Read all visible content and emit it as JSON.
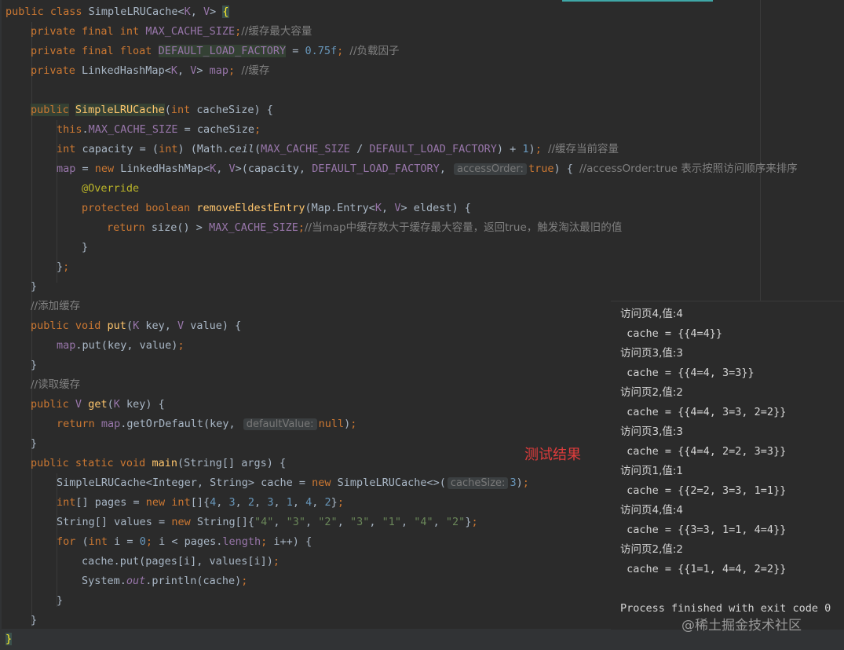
{
  "code": {
    "l1": {
      "kw": "public class ",
      "cls": "SimpleLRUCache",
      "lt": "<",
      "tp1": "K",
      "comma": ", ",
      "tp2": "V",
      "gt": "> ",
      "brace": "{"
    },
    "l2": {
      "kw": "private final int ",
      "fld": "MAX_CACHE_SIZE",
      "semi": ";",
      "cmt": "//缓存最大容量"
    },
    "l3": {
      "kw": "private final float ",
      "fld": "DEFAULT_LOAD_FACTORY",
      "eq": " = ",
      "num": "0.75f",
      "semi": "; ",
      "cmt": "//负载因子"
    },
    "l4": {
      "kw": "private ",
      "type": "LinkedHashMap",
      "lt": "<",
      "tp1": "K",
      "comma": ", ",
      "tp2": "V",
      "gt": "> ",
      "fld": "map",
      "semi": "; ",
      "cmt": "//缓存"
    },
    "l6": {
      "kw": "public",
      "sp": " ",
      "mth": "SimpleLRUCache",
      "lp": "(",
      "kw2": "int",
      "param": " cacheSize) {"
    },
    "l7": {
      "kw": "this",
      "dot": ".",
      "fld": "MAX_CACHE_SIZE",
      "rest": " = cacheSize",
      "semi": ";"
    },
    "l8": {
      "kw": "int",
      "a": " capacity = (",
      "kw2": "int",
      "b": ") (Math.",
      "st": "ceil",
      "c": "(",
      "fld": "MAX_CACHE_SIZE",
      "d": " / ",
      "fld2": "DEFAULT_LOAD_FACTORY",
      "e": ") + ",
      "num": "1",
      "f": ")",
      "semi": "; ",
      "cmt": "//缓存当前容量"
    },
    "l9": {
      "fld": "map",
      "a": " = ",
      "kw": "new",
      "b": " LinkedHashMap",
      "lt": "<",
      "tp1": "K",
      "comma": ", ",
      "tp2": "V",
      "gt": ">(capacity, ",
      "fld2": "DEFAULT_LOAD_FACTORY",
      "c": ", ",
      "hint": "accessOrder:",
      "kw2": "true",
      "d": ") { ",
      "cmt": "//accessOrder:true 表示按照访问顺序来排序"
    },
    "l10": {
      "ann": "@Override"
    },
    "l11": {
      "kw": "protected boolean ",
      "mth": "removeEldestEntry",
      "a": "(Map.Entry",
      "lt": "<",
      "tp1": "K",
      "comma": ", ",
      "tp2": "V",
      "gt": "> eldest) {"
    },
    "l12": {
      "kw": "return",
      "a": " size() > ",
      "fld": "MAX_CACHE_SIZE",
      "semi": ";",
      "cmt": "//当map中缓存数大于缓存最大容量，返回true，触发淘汰最旧的值"
    },
    "l13": {
      "a": "}"
    },
    "l14": {
      "a": "}",
      "semi": ";"
    },
    "l15": {
      "a": "}"
    },
    "l16": {
      "cmt": "//添加缓存"
    },
    "l17": {
      "kw": "public void ",
      "mth": "put",
      "a": "(",
      "tp1": "K",
      "b": " key, ",
      "tp2": "V",
      "c": " value) {"
    },
    "l18": {
      "fld": "map",
      "a": ".put(key, ",
      "b": "value)",
      "semi": ";"
    },
    "l19": {
      "a": "}"
    },
    "l20": {
      "cmt": "//读取缓存"
    },
    "l21": {
      "kw": "public ",
      "tp": "V",
      "sp": " ",
      "mth": "get",
      "a": "(",
      "tp1": "K",
      "b": " key) {"
    },
    "l22": {
      "kw": "return ",
      "fld": "map",
      "a": ".getOrDefault(key, ",
      "hint": "defaultValue:",
      "kw2": "null",
      "b": ")",
      "semi": ";"
    },
    "l23": {
      "a": "}"
    },
    "l24": {
      "kw": "public static void ",
      "mth": "main",
      "a": "(String[] args) {"
    },
    "l25": {
      "a": "SimpleLRUCache",
      "lt": "<",
      "b": "Integer, String",
      "gt": ">",
      "c": " cache = ",
      "kw": "new",
      "d": " SimpleLRUCache<>(",
      "hint": "cacheSize:",
      "num": "3",
      "e": ")",
      "semi": ";"
    },
    "l26": {
      "kw": "int",
      "a": "[] pages = ",
      "kw2": "new int",
      "b": "[]{",
      "n1": "4",
      "c1": ", ",
      "n2": "3",
      "c2": ", ",
      "n3": "2",
      "c3": ", ",
      "n4": "3",
      "c4": ", ",
      "n5": "1",
      "c5": ", ",
      "n6": "4",
      "c6": ", ",
      "n7": "2",
      "e": "}",
      "semi": ";"
    },
    "l27": {
      "a": "String[] values = ",
      "kw": "new",
      "b": " String[]{",
      "s1": "\"4\"",
      "c1": ", ",
      "s2": "\"3\"",
      "c2": ", ",
      "s3": "\"2\"",
      "c3": ", ",
      "s4": "\"3\"",
      "c4": ", ",
      "s5": "\"1\"",
      "c5": ", ",
      "s6": "\"4\"",
      "c6": ", ",
      "s7": "\"2\"",
      "e": "}",
      "semi": ";"
    },
    "l28": {
      "kw": "for",
      "a": " (",
      "kw2": "int",
      "b": " i = ",
      "num": "0",
      "semi": ";",
      "c": " i < pages.",
      "fld": "length",
      "semi2": ";",
      "d": " i++) {"
    },
    "l29": {
      "a": "cache.put(pages[i], values[i])",
      "semi": ";"
    },
    "l30": {
      "a": "System.",
      "st": "out",
      "b": ".println(cache)",
      "semi": ";"
    },
    "l31": {
      "a": "}"
    },
    "l32": {
      "a": "}"
    },
    "l33": {
      "brace": "}"
    }
  },
  "console": {
    "lines": [
      "访问页4,值:4",
      " cache = {{4=4}}",
      "访问页3,值:3",
      " cache = {{4=4, 3=3}}",
      "访问页2,值:2",
      " cache = {{4=4, 3=3, 2=2}}",
      "访问页3,值:3",
      " cache = {{4=4, 2=2, 3=3}}",
      "访问页1,值:1",
      " cache = {{2=2, 3=3, 1=1}}",
      "访问页4,值:4",
      " cache = {{3=3, 1=1, 4=4}}",
      "访问页2,值:2",
      " cache = {{1=1, 4=4, 2=2}}"
    ],
    "exit": "Process finished with exit code 0"
  },
  "result_label": "测试结果",
  "watermark": "@稀土掘金技术社区",
  "colors": {
    "background": "#2b2b2b",
    "keyword": "#cc7832",
    "field": "#9876aa",
    "method": "#ffc66d",
    "number": "#6897bb",
    "string": "#6a8759",
    "comment": "#808080",
    "annotation": "#bbb529",
    "result_label": "#e03c3c"
  }
}
